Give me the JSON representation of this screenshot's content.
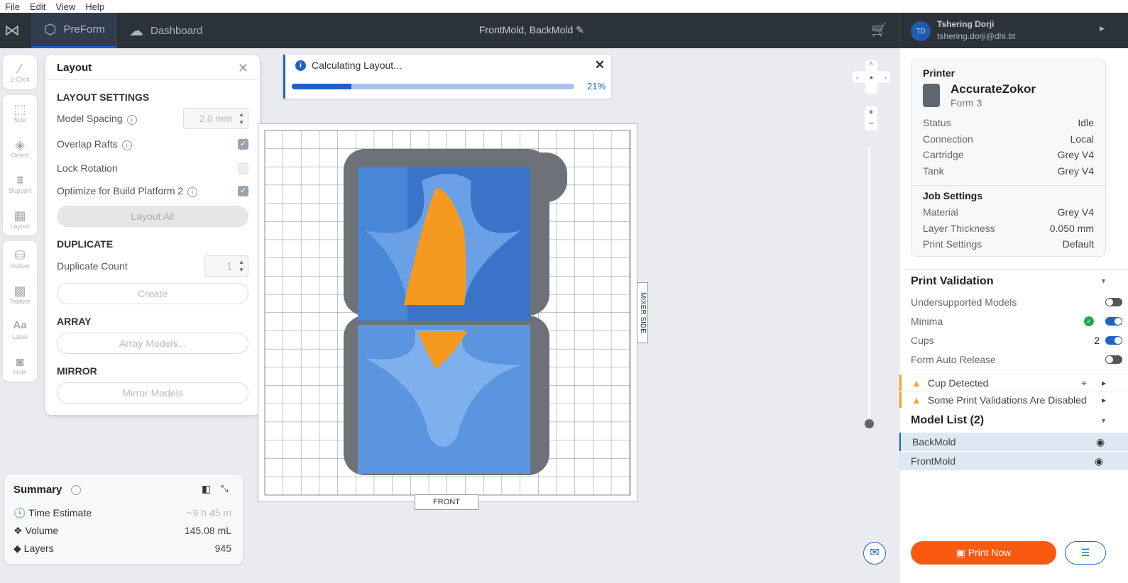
{
  "menu": [
    "File",
    "Edit",
    "View",
    "Help"
  ],
  "topbar": {
    "tabs": [
      {
        "label": "PreForm",
        "icon": "box-icon"
      },
      {
        "label": "Dashboard",
        "icon": "cloud-icon"
      }
    ],
    "title": "FrontMold, BackMold",
    "user": {
      "initials": "TD",
      "name": "Tshering Dorji",
      "email": "tshering.dorji@dhi.bt"
    }
  },
  "tools": [
    {
      "label": "1-Click",
      "icon": "magic-wand-icon"
    },
    {
      "label": "Size",
      "icon": "size-icon"
    },
    {
      "label": "Orient",
      "icon": "orient-icon"
    },
    {
      "label": "Support",
      "icon": "support-icon"
    },
    {
      "label": "Layout",
      "icon": "layout-icon"
    },
    {
      "label": "Hollow",
      "icon": "hollow-icon"
    },
    {
      "label": "Texture",
      "icon": "texture-icon"
    },
    {
      "label": "Label",
      "icon": "label-icon"
    },
    {
      "label": "Hole",
      "icon": "hole-icon"
    }
  ],
  "layout": {
    "title": "Layout",
    "settings_header": "LAYOUT SETTINGS",
    "model_spacing_label": "Model Spacing",
    "model_spacing_value": "2.0 mm",
    "overlap_rafts_label": "Overlap Rafts",
    "overlap_rafts": true,
    "lock_rotation_label": "Lock Rotation",
    "lock_rotation": false,
    "optimize_label": "Optimize for Build Platform 2",
    "optimize": true,
    "layout_all": "Layout All",
    "duplicate_header": "DUPLICATE",
    "duplicate_count_label": "Duplicate Count",
    "duplicate_count": "1",
    "create": "Create",
    "array_header": "ARRAY",
    "array_models": "Array Models...",
    "mirror_header": "MIRROR",
    "mirror_models": "Mirror Models"
  },
  "progress": {
    "label": "Calculating Layout...",
    "percent": 21,
    "percent_text": "21%"
  },
  "plate": {
    "front": "FRONT",
    "mixer_side": "MIXER SIDE"
  },
  "summary": {
    "title": "Summary",
    "time_label": "Time Estimate",
    "time_value": "~9 h 45 m",
    "volume_label": "Volume",
    "volume_value": "145.08 mL",
    "layers_label": "Layers",
    "layers_value": "945"
  },
  "printer": {
    "header": "Printer",
    "name": "AccurateZokor",
    "model": "Form 3",
    "status": [
      [
        "Status",
        "Idle"
      ],
      [
        "Connection",
        "Local"
      ],
      [
        "Cartridge",
        "Grey V4"
      ],
      [
        "Tank",
        "Grey V4"
      ]
    ],
    "job_header": "Job Settings",
    "job": [
      [
        "Material",
        "Grey V4"
      ],
      [
        "Layer Thickness",
        "0.050 mm"
      ],
      [
        "Print Settings",
        "Default"
      ]
    ]
  },
  "validation": {
    "title": "Print Validation",
    "items": [
      {
        "label": "Undersupported Models",
        "on": false,
        "extra": ""
      },
      {
        "label": "Minima",
        "on": true,
        "extra": ""
      },
      {
        "label": "Cups",
        "on": true,
        "extra": "2"
      },
      {
        "label": "Form Auto Release",
        "on": false,
        "extra": ""
      }
    ],
    "warnings": [
      "Cup Detected",
      "Some Print Validations Are Disabled"
    ]
  },
  "models": {
    "title": "Model List (2)",
    "items": [
      "BackMold",
      "FrontMold"
    ]
  },
  "print_now": "Print Now",
  "colors": {
    "accent": "#1f63c6",
    "print": "#fa5a0f",
    "model_blue": "#4a86d8",
    "orange": "#f59a1e",
    "warning": "#f5a623"
  }
}
